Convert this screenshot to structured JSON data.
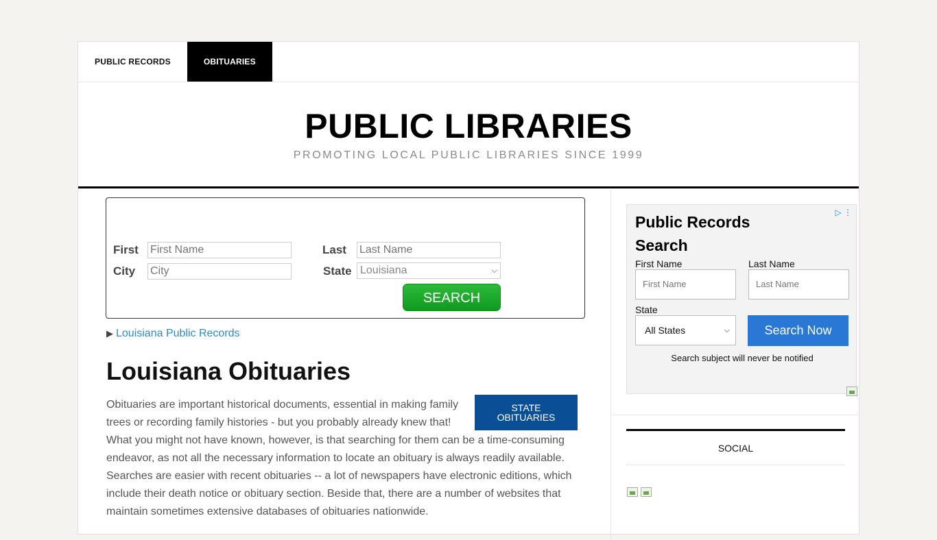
{
  "nav": {
    "items": [
      {
        "label": "PUBLIC RECORDS",
        "active": false
      },
      {
        "label": "OBITUARIES",
        "active": true
      }
    ]
  },
  "header": {
    "title": "PUBLIC LIBRARIES",
    "tagline": "PROMOTING LOCAL PUBLIC LIBRARIES SINCE 1999"
  },
  "search_form": {
    "first_label": "First",
    "first_placeholder": "First Name",
    "last_label": "Last",
    "last_placeholder": "Last Name",
    "city_label": "City",
    "city_placeholder": "City",
    "state_label": "State",
    "state_value": "Louisiana",
    "button_label": "SEARCH"
  },
  "records_link": {
    "label": "Louisiana Public Records"
  },
  "content": {
    "heading": "Louisiana Obituaries",
    "state_button": "STATE OBITUARIES",
    "paragraph_lines": [
      "Obituaries are important historical documents, essential in making family",
      "trees or recording family histories - but you probably already knew that!",
      "What you might not have known, however, is that searching for them can be a time-consuming",
      "endeavor, as not all the necessary information to locate an obituary is always readily available.",
      "Searches are easier with recent obituaries -- a lot of newspapers have electronic editions, which",
      "include their death notice or obituary section. Beside that, there are a number of websites that",
      "maintain sometimes extensive databases of obituaries nationwide."
    ]
  },
  "ad": {
    "title": "Public Records Search",
    "first_label": "First Name",
    "first_placeholder": "First Name",
    "last_label": "Last Name",
    "last_placeholder": "Last Name",
    "state_label": "State",
    "state_value": "All States",
    "button_label": "Search Now",
    "note": "Search subject will never be notified"
  },
  "sidebar": {
    "social_title": "SOCIAL"
  },
  "colors": {
    "search_button": "#1aa82a",
    "state_button": "#0a4f96",
    "ad_button": "#2a78d6",
    "link": "#2a8bd0"
  }
}
